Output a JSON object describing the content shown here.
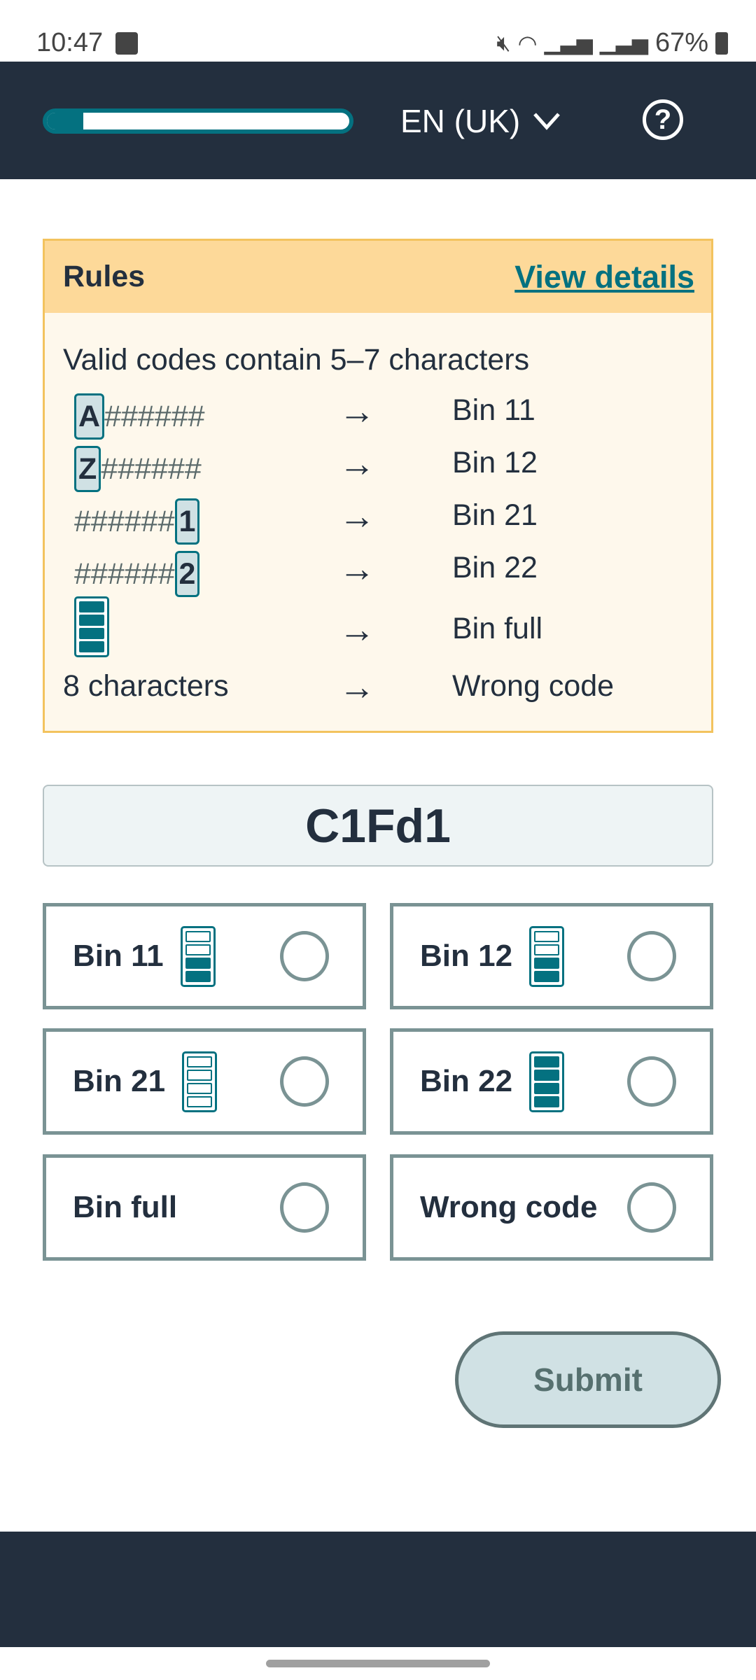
{
  "status_bar": {
    "time": "10:47",
    "battery": "67%",
    "icons": [
      "gallery-icon",
      "mute-icon",
      "wifi-icon",
      "signal-icon",
      "signal-icon",
      "battery-icon"
    ]
  },
  "header": {
    "progress_percent": 12,
    "language": "EN (UK)",
    "help_icon": "help-icon",
    "colors": {
      "bg": "#232f3e",
      "accent": "#047180"
    }
  },
  "rules": {
    "title": "Rules",
    "view_details": "View details",
    "intro": "Valid codes contain 5–7 characters",
    "rows": [
      {
        "prefix": "A",
        "hashes": "######",
        "suffix": "",
        "arrow": "→",
        "bin": "Bin 11"
      },
      {
        "prefix": "Z",
        "hashes": "######",
        "suffix": "",
        "arrow": "→",
        "bin": "Bin 12"
      },
      {
        "prefix": "",
        "hashes": "######",
        "suffix": "1",
        "arrow": "→",
        "bin": "Bin 21"
      },
      {
        "prefix": "",
        "hashes": "######",
        "suffix": "2",
        "arrow": "→",
        "bin": "Bin 22"
      },
      {
        "icon": "bin-full-icon",
        "fill_level": 4,
        "arrow": "→",
        "bin": "Bin full"
      },
      {
        "text": "8 characters",
        "arrow": "→",
        "bin": "Wrong code"
      }
    ]
  },
  "code": "C1Fd1",
  "options": [
    {
      "label": "Bin 11",
      "fill_level": 2,
      "max": 4
    },
    {
      "label": "Bin 12",
      "fill_level": 2,
      "max": 4
    },
    {
      "label": "Bin 21",
      "fill_level": 0,
      "max": 4
    },
    {
      "label": "Bin 22",
      "fill_level": 4,
      "max": 4
    },
    {
      "label": "Bin full"
    },
    {
      "label": "Wrong code"
    }
  ],
  "submit": "Submit"
}
